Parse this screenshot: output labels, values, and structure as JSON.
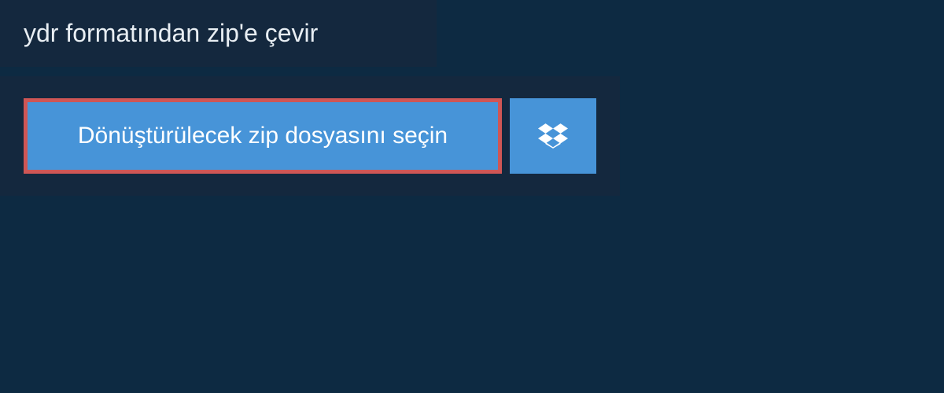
{
  "header": {
    "title": "ydr formatından zip'e çevir"
  },
  "actions": {
    "select_file_label": "Dönüştürülecek zip dosyasını seçin",
    "dropbox_icon_name": "dropbox-icon"
  },
  "colors": {
    "background": "#0d2a42",
    "panel": "#14283e",
    "button_primary": "#4794d8",
    "button_highlight_border": "#cf5655",
    "text_light": "#e8eef3",
    "text_white": "#ffffff"
  }
}
